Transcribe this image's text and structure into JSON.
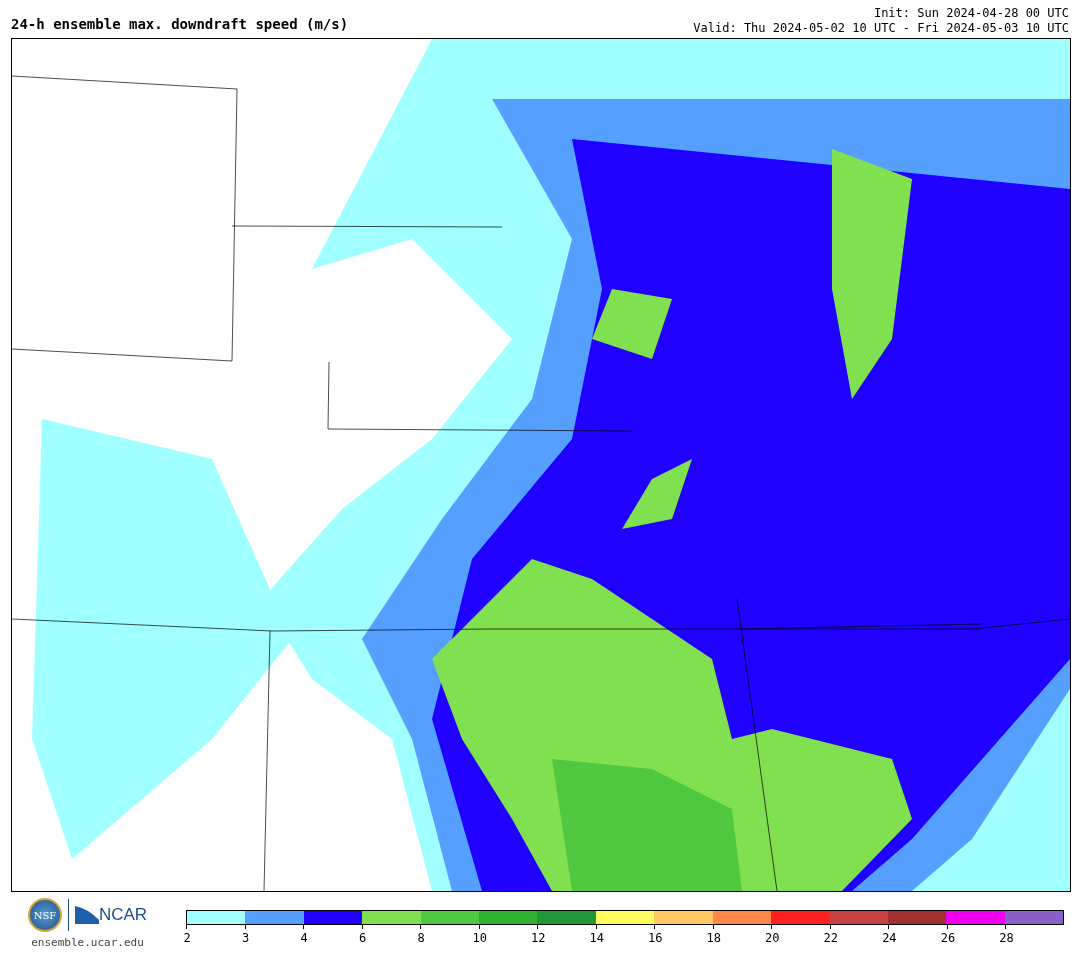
{
  "title": "24-h ensemble max. downdraft speed (m/s)",
  "init": "Init: Sun 2024-04-28 00 UTC",
  "valid": "Valid: Thu 2024-05-02 10 UTC - Fri 2024-05-03 10 UTC",
  "logos": {
    "nsf": "NSF",
    "ncar": "NCAR",
    "url": "ensemble.ucar.edu"
  },
  "colorbar": {
    "bins": [
      {
        "color": "#a0ffff",
        "tick": "2"
      },
      {
        "color": "#55a0ff",
        "tick": "3"
      },
      {
        "color": "#2000ff",
        "tick": "4"
      },
      {
        "color": "#80e050",
        "tick": "6"
      },
      {
        "color": "#50c840",
        "tick": "8"
      },
      {
        "color": "#30b030",
        "tick": "10"
      },
      {
        "color": "#209838",
        "tick": "12"
      },
      {
        "color": "#ffff60",
        "tick": "14"
      },
      {
        "color": "#ffc860",
        "tick": "16"
      },
      {
        "color": "#ff8848",
        "tick": "18"
      },
      {
        "color": "#ff2020",
        "tick": "20"
      },
      {
        "color": "#c84040",
        "tick": "22"
      },
      {
        "color": "#a03030",
        "tick": "24"
      },
      {
        "color": "#f000f0",
        "tick": "26"
      },
      {
        "color": "#8860c8",
        "tick": "28"
      }
    ]
  }
}
